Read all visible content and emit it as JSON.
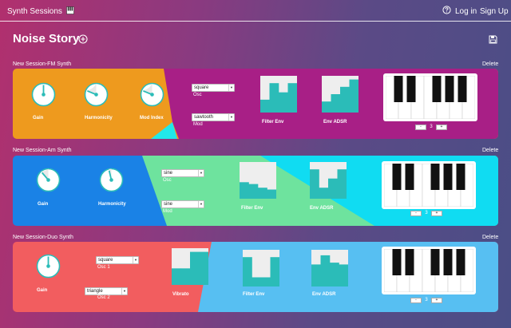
{
  "nav": {
    "brand": "Synth Sessions",
    "brand_icon": "keyboard-icon",
    "help_icon": "help-circle-icon",
    "login": "Log in",
    "signup": "Sign Up"
  },
  "story": {
    "title": "Noise Story",
    "add_icon": "plus-circle-icon",
    "save_icon": "floppy-disk-icon"
  },
  "sessions": [
    {
      "title": "New Session-FM Synth",
      "delete": "Delete",
      "colors": [
        "#ee9a1e",
        "#a81f86",
        "#22e8ea"
      ],
      "knobs": [
        {
          "label": "Gain",
          "value": 0.5
        },
        {
          "label": "Harmonicity",
          "value": 0.25
        },
        {
          "label": "Mod Index",
          "value": 0.25
        }
      ],
      "selects": [
        {
          "label": "Osc",
          "value": "square"
        },
        {
          "label": "Mod",
          "value": "sawtooth"
        }
      ],
      "envelopes": [
        {
          "label": "Filter Env",
          "levels": [
            0.35,
            0.8,
            0.55,
            0.8
          ]
        },
        {
          "label": "Env ADSR",
          "levels": [
            0.3,
            0.5,
            0.7,
            0.9
          ]
        }
      ],
      "octave": "3"
    },
    {
      "title": "New Session-Am Synth",
      "delete": "Delete",
      "colors": [
        "#1a82e6",
        "#6ee39e",
        "#10dcf2"
      ],
      "knobs": [
        {
          "label": "Gain",
          "value": 0.35
        },
        {
          "label": "Harmonicity",
          "value": 0.45
        }
      ],
      "selects": [
        {
          "label": "Osc",
          "value": "sine"
        },
        {
          "label": "Mod",
          "value": "sine"
        }
      ],
      "envelopes": [
        {
          "label": "Filter Env",
          "levels": [
            0.45,
            0.4,
            0.3,
            0.25
          ]
        },
        {
          "label": "Env ADSR",
          "levels": [
            0.8,
            0.3,
            0.55,
            0.8
          ]
        }
      ],
      "octave": "3"
    },
    {
      "title": "New Session-Duo Synth",
      "delete": "Delete",
      "colors": [
        "#f25d5f",
        "#57bff2"
      ],
      "knobs": [
        {
          "label": "Gain",
          "value": 0.5
        }
      ],
      "selects": [
        {
          "label": "Osc 1",
          "value": "square"
        },
        {
          "label": "Osc 2",
          "value": "triangle"
        }
      ],
      "envelopes": [
        {
          "label": "Vibrato",
          "levels": [
            0.45,
            0.45,
            0.9,
            0.9
          ]
        },
        {
          "label": "Filter Env",
          "levels": [
            0.8,
            0.25,
            0.25,
            0.8
          ]
        },
        {
          "label": "Env ADSR",
          "levels": [
            0.6,
            0.85,
            0.65,
            0.6
          ]
        }
      ],
      "octave": "3"
    }
  ]
}
